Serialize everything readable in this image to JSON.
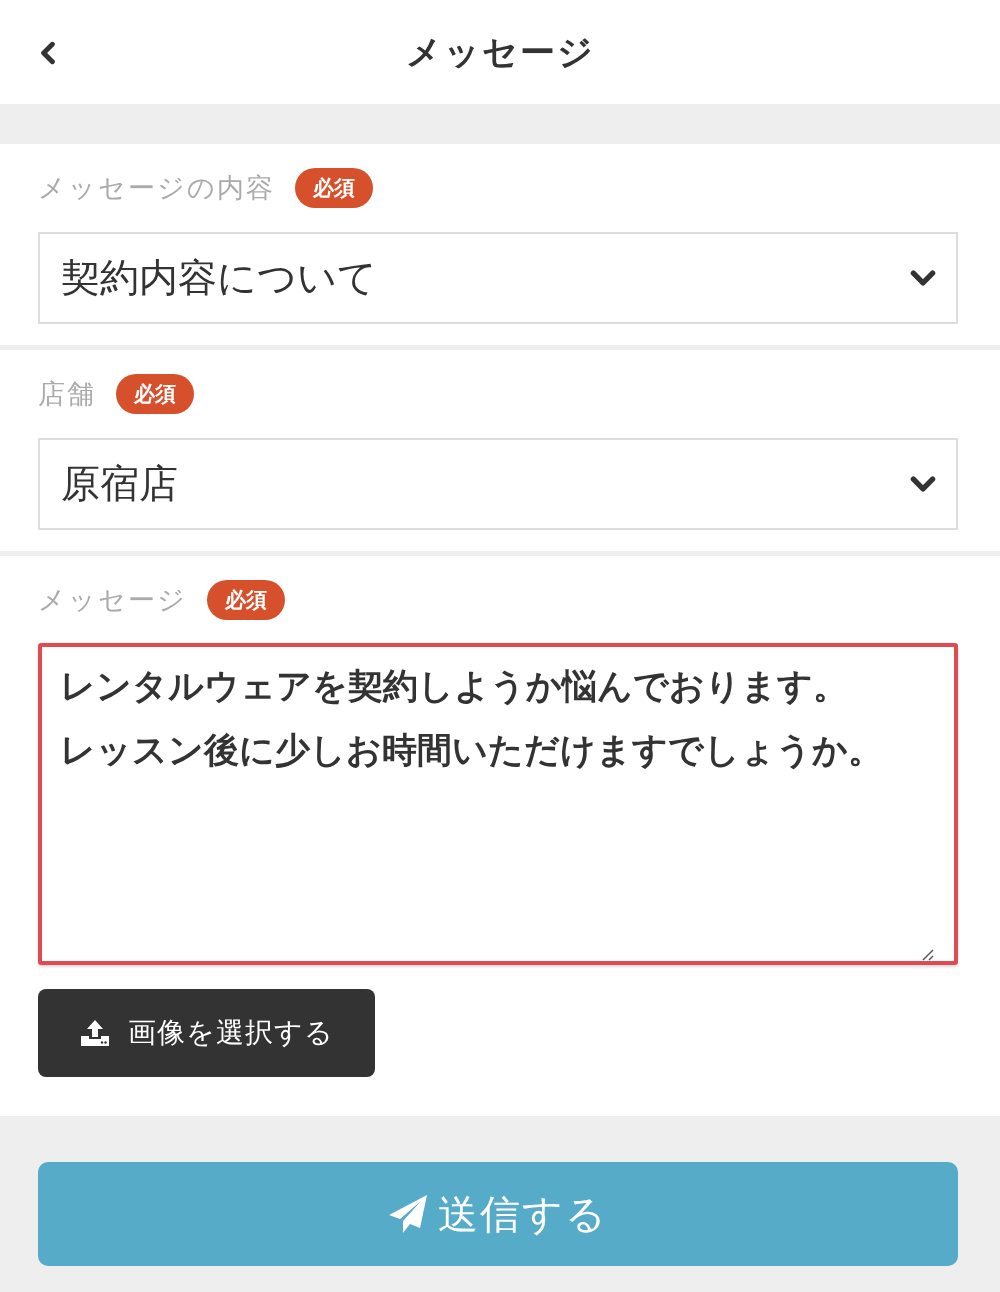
{
  "header": {
    "title": "メッセージ"
  },
  "fields": [
    {
      "kind": "select",
      "label": "メッセージの内容",
      "badge": "必須",
      "value": "契約内容について",
      "focused": false
    },
    {
      "kind": "select",
      "label": "店舗",
      "badge": "必須",
      "value": "原宿店",
      "focused": false
    },
    {
      "kind": "textarea",
      "label": "メッセージ",
      "badge": "必須",
      "value_lines": [
        "レンタルウェアを契約しようか悩んでおります。",
        "レッスン後に少しお時間いただけますでしょうか。"
      ],
      "focused": true,
      "attachment_button": "画像を選択する"
    }
  ],
  "submit_button": {
    "label": "送信する"
  }
}
